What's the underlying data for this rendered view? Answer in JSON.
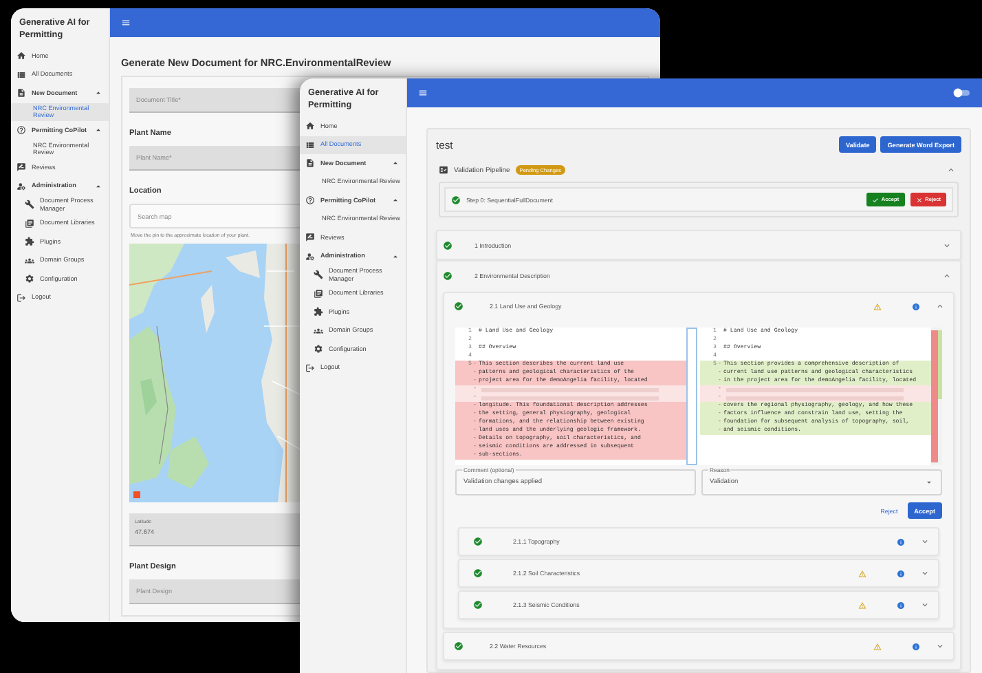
{
  "back_window": {
    "sidebar": {
      "title": "Generative AI for Permitting",
      "items": [
        {
          "label": "Home",
          "selected": false
        },
        {
          "label": "All Documents",
          "selected": false
        },
        {
          "label": "New Document",
          "selected": false,
          "expanded": true,
          "children": [
            {
              "label": "NRC Environmental Review",
              "selected": true
            }
          ]
        },
        {
          "label": "Permitting CoPilot",
          "selected": false,
          "expanded": true,
          "children": [
            {
              "label": "NRC Environmental Review",
              "selected": false
            }
          ]
        },
        {
          "label": "Reviews",
          "selected": false
        },
        {
          "label": "Administration",
          "selected": false,
          "expanded": true,
          "children": [
            {
              "label": "Document Process Manager",
              "selected": false
            },
            {
              "label": "Document Libraries",
              "selected": false
            },
            {
              "label": "Plugins",
              "selected": false
            },
            {
              "label": "Domain Groups",
              "selected": false
            },
            {
              "label": "Configuration",
              "selected": false
            }
          ]
        },
        {
          "label": "Logout",
          "selected": false
        }
      ]
    },
    "page_title": "Generate New Document for NRC.EnvironmentalReview",
    "form": {
      "document_title": {
        "placeholder": "Document Title*"
      },
      "plant_name_heading": "Plant Name",
      "plant_name": {
        "placeholder": "Plant Name*"
      },
      "location_heading": "Location",
      "map_search": {
        "placeholder": "Search map"
      },
      "map_hint": "Move the pin to the approximate location of your plant.",
      "latitude": {
        "label": "Latitude",
        "value": "47.674"
      },
      "plant_design_heading": "Plant Design",
      "plant_design": {
        "placeholder": "Plant Design"
      }
    }
  },
  "front_window": {
    "sidebar": {
      "title": "Generative AI for Permitting",
      "items": [
        {
          "label": "Home",
          "selected": false
        },
        {
          "label": "All Documents",
          "selected": true
        },
        {
          "label": "New Document",
          "selected": false,
          "expanded": true,
          "children": [
            {
              "label": "NRC Environmental Review",
              "selected": false
            }
          ]
        },
        {
          "label": "Permitting CoPilot",
          "selected": false,
          "expanded": true,
          "children": [
            {
              "label": "NRC Environmental Review",
              "selected": false
            }
          ]
        },
        {
          "label": "Reviews",
          "selected": false
        },
        {
          "label": "Administration",
          "selected": false,
          "expanded": true,
          "children": [
            {
              "label": "Document Process Manager",
              "selected": false
            },
            {
              "label": "Document Libraries",
              "selected": false
            },
            {
              "label": "Plugins",
              "selected": false
            },
            {
              "label": "Domain Groups",
              "selected": false
            },
            {
              "label": "Configuration",
              "selected": false
            }
          ]
        },
        {
          "label": "Logout",
          "selected": false
        }
      ]
    },
    "document_title": "test",
    "actions": [
      "Validate",
      "Generate Word Export"
    ],
    "pipeline": {
      "title": "Validation Pipeline",
      "badge": "Pending Changes",
      "expanded": true,
      "steps": [
        {
          "label": "Step 0: SequentialFullDocument",
          "complete": true,
          "actions": [
            "Accept",
            "Reject"
          ]
        }
      ]
    },
    "sections": [
      {
        "label": "1 Introduction",
        "complete": true,
        "warning": false,
        "info": false,
        "expanded": false
      },
      {
        "label": "2 Environmental Description",
        "complete": true,
        "warning": false,
        "info": false,
        "expanded": true,
        "children": [
          {
            "label": "2.1 Land Use and Geology",
            "complete": true,
            "warning": true,
            "info": true,
            "expanded": true,
            "review": {
              "diff": {
                "left": [
                  {
                    "num": "1",
                    "text": "# Land Use and Geology",
                    "kind": "context"
                  },
                  {
                    "num": "2",
                    "kind": "context"
                  },
                  {
                    "num": "3",
                    "text": "## Overview",
                    "kind": "context"
                  },
                  {
                    "num": "4",
                    "kind": "context"
                  },
                  {
                    "num": "5",
                    "sign": "-",
                    "text": "This section describes the current land use",
                    "kind": "removed"
                  },
                  {
                    "sign": "-",
                    "text": "patterns and geological characteristics of the",
                    "kind": "removed"
                  },
                  {
                    "sign": "-",
                    "text": "project area for the demoAngelia facility, located",
                    "kind": "removed"
                  },
                  {
                    "sign": "-",
                    "kind": "redacted"
                  },
                  {
                    "sign": "-",
                    "kind": "redacted"
                  },
                  {
                    "sign": "-",
                    "text": "longitude. This foundational description addresses",
                    "kind": "removed"
                  },
                  {
                    "sign": "-",
                    "text": "the setting, general physiography, geological",
                    "kind": "removed"
                  },
                  {
                    "sign": "-",
                    "text": "formations, and the relationship between existing",
                    "kind": "removed"
                  },
                  {
                    "sign": "-",
                    "text": "land uses and the underlying geologic framework.",
                    "kind": "removed"
                  },
                  {
                    "sign": "-",
                    "text": "Details on topography, soil characteristics, and",
                    "kind": "removed"
                  },
                  {
                    "sign": "-",
                    "text": "seismic conditions are addressed in subsequent",
                    "kind": "removed"
                  },
                  {
                    "sign": "-",
                    "text": "sub-sections.",
                    "kind": "removed"
                  }
                ],
                "right": [
                  {
                    "num": "1",
                    "text": "# Land Use and Geology",
                    "kind": "context"
                  },
                  {
                    "num": "2",
                    "kind": "context"
                  },
                  {
                    "num": "3",
                    "text": "## Overview",
                    "kind": "context"
                  },
                  {
                    "num": "4",
                    "kind": "context"
                  },
                  {
                    "num": "5",
                    "sign": "-",
                    "text": "This section provides a comprehensive description of",
                    "kind": "added"
                  },
                  {
                    "sign": "-",
                    "text": "current land use patterns and geological characteristics",
                    "kind": "added"
                  },
                  {
                    "sign": "-",
                    "text": "in the project area for the demoAngelia facility, located",
                    "kind": "added"
                  },
                  {
                    "sign": "-",
                    "kind": "redacted"
                  },
                  {
                    "sign": "-",
                    "kind": "redacted"
                  },
                  {
                    "sign": "-",
                    "text": "covers the regional physiography, geology, and how these",
                    "kind": "added"
                  },
                  {
                    "sign": "-",
                    "text": "factors influence and constrain land use, setting the",
                    "kind": "added"
                  },
                  {
                    "sign": "-",
                    "text": "foundation for subsequent analysis of topography, soil,",
                    "kind": "added"
                  },
                  {
                    "sign": "-",
                    "text": "and seismic conditions.",
                    "kind": "added"
                  }
                ]
              },
              "comment": {
                "label": "Comment (optional)",
                "value": "Validation changes applied"
              },
              "reason": {
                "label": "Reason",
                "value": "Validation"
              },
              "actions": [
                "Reject",
                "Accept"
              ]
            },
            "children": [
              {
                "label": "2.1.1 Topography",
                "complete": true,
                "warning": false,
                "info": true,
                "expanded": false
              },
              {
                "label": "2.1.2 Soil Characteristics",
                "complete": true,
                "warning": true,
                "info": true,
                "expanded": false
              },
              {
                "label": "2.1.3 Seismic Conditions",
                "complete": true,
                "warning": true,
                "info": true,
                "expanded": false
              }
            ]
          },
          {
            "label": "2.2 Water Resources",
            "complete": true,
            "warning": true,
            "info": true,
            "expanded": false
          }
        ]
      }
    ]
  }
}
